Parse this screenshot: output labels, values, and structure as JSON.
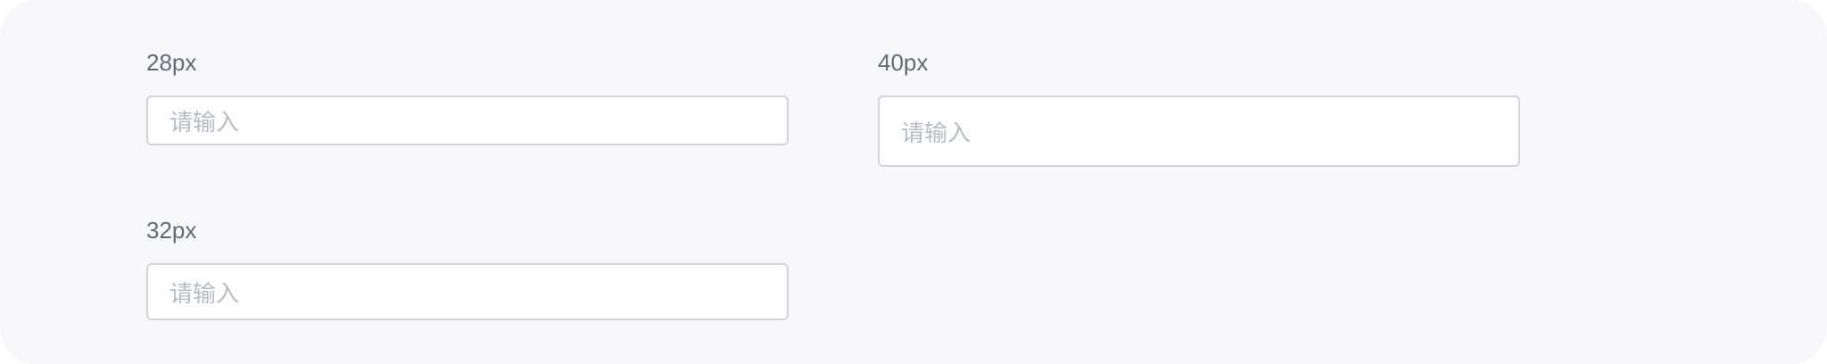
{
  "inputs": {
    "small": {
      "label": "28px",
      "placeholder": "请输入",
      "value": ""
    },
    "large": {
      "label": "40px",
      "placeholder": "请输入",
      "value": ""
    },
    "medium": {
      "label": "32px",
      "placeholder": "请输入",
      "value": ""
    }
  },
  "colors": {
    "panel_background": "#f8f8fa",
    "label_text": "#646a73",
    "placeholder_text": "#b8bbc1",
    "input_border": "#d2d4d8",
    "input_background": "#ffffff"
  }
}
